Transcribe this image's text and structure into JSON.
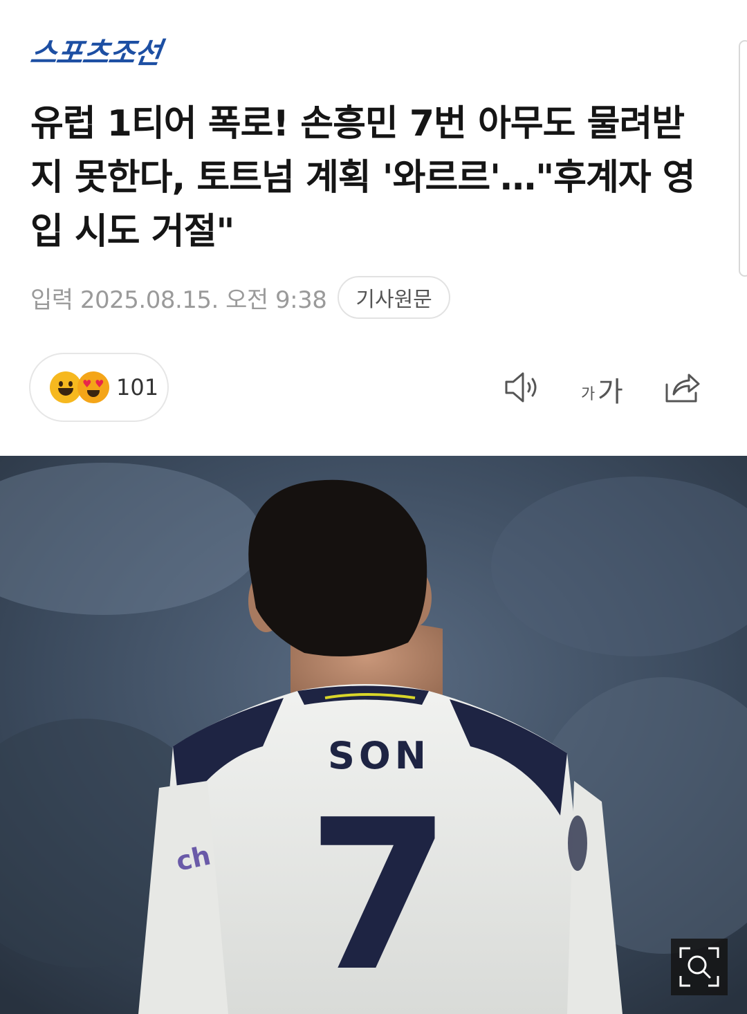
{
  "header": {
    "publisher_logo": "스포츠조선"
  },
  "article": {
    "headline": "유럽 1티어 폭로! 손흥민 7번 아무도 물려받지 못한다, 토트넘 계획 '와르르'…\"후계자 영입 시도 거절\"",
    "published": "입력 2025.08.15. 오전 9:38",
    "original_link_label": "기사원문"
  },
  "reactions": {
    "count": "101",
    "emoji_icons": [
      "grinning-face-icon",
      "heart-eyes-face-icon"
    ]
  },
  "toolbar": {
    "icons": [
      "speaker-icon",
      "font-size-icon",
      "share-icon"
    ],
    "font_size_small": "가",
    "font_size_large": "가"
  },
  "photo": {
    "jersey_name": "SON",
    "jersey_number": "7",
    "sleeve_text": "ch",
    "zoom_icon": "zoom-icon"
  },
  "colors": {
    "logo_blue": "#1d4fa3",
    "meta_gray": "#9a9a9a",
    "jersey_navy": "#1e2443"
  }
}
